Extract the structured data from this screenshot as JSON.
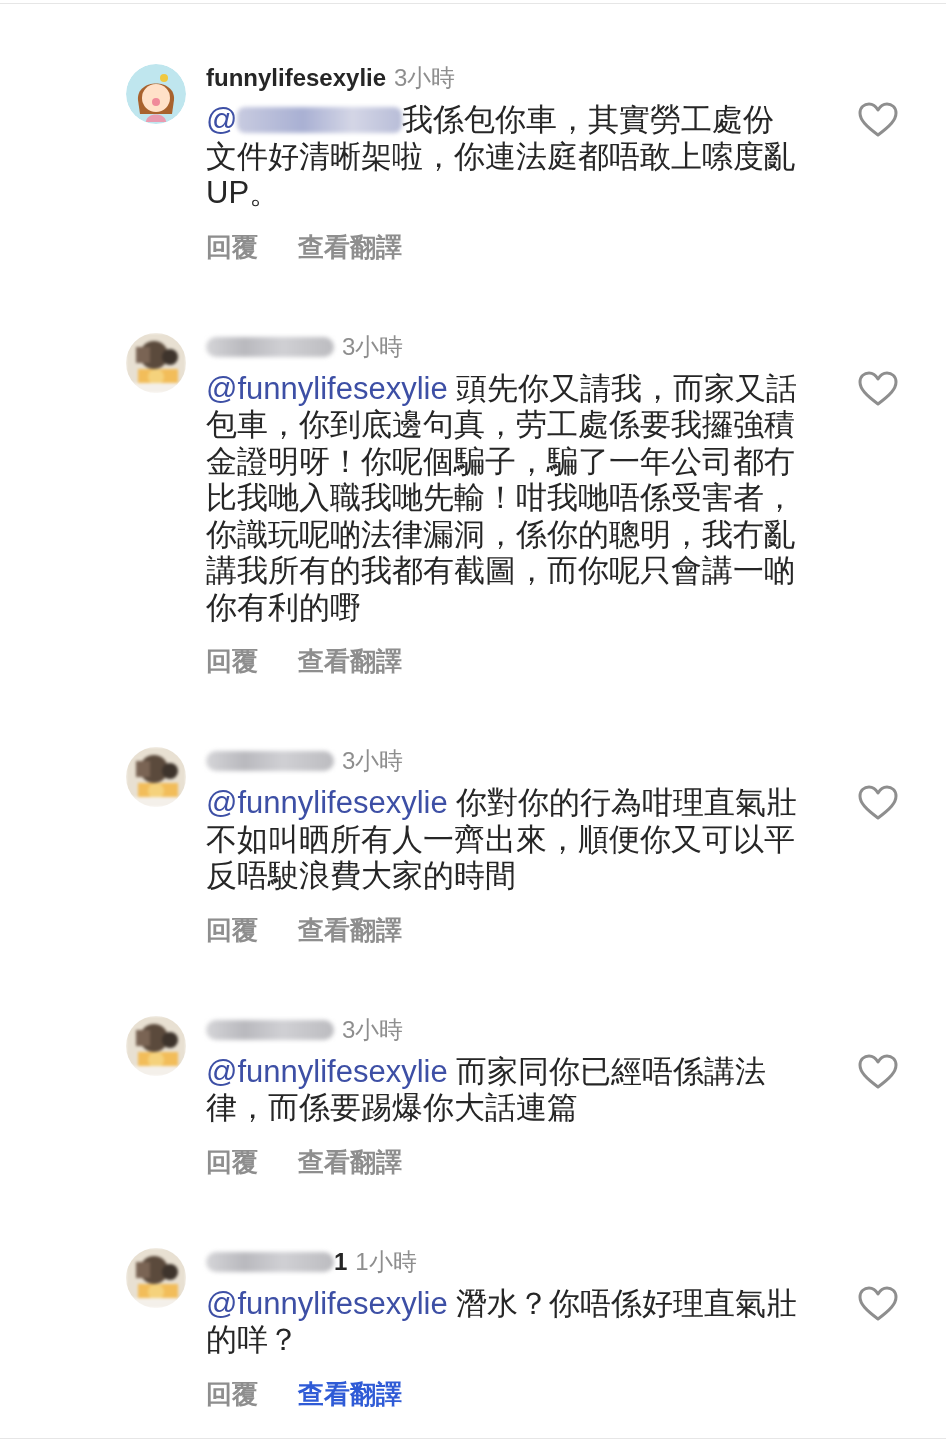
{
  "comments": [
    {
      "avatar": {
        "kind": "cartoon"
      },
      "username": "funnylifesexylie",
      "username_blurred": false,
      "time": "3小時",
      "mention": "@",
      "mention_blurred": true,
      "text": "我係包你車，其實勞工處份文件好清晰架啦，你連法庭都唔敢上嗦度亂UP。",
      "liked": false,
      "reply": "回覆",
      "translate": "查看翻譯",
      "translate_active": false
    },
    {
      "username_blurred": true,
      "time": "3小時",
      "mention": "@funnylifesexylie",
      "mention_blurred": false,
      "text": "頭先你又請我，而家又話包車，你到底邊句真，劳工處係要我攞強積金證明呀！你呢個騙子，騙了一年公司都冇比我哋入職我哋先輸！咁我哋唔係受害者，你識玩呢啲法律漏洞，係你的聰明，我冇亂講我所有的我都有截圖，而你呢只會講一啲你有利的嘢",
      "liked": false,
      "reply": "回覆",
      "translate": "查看翻譯",
      "translate_active": false
    },
    {
      "username_blurred": true,
      "time": "3小時",
      "mention": "@funnylifesexylie",
      "mention_blurred": false,
      "text": "你對你的行為咁理直氣壯不如叫晒所有人一齊出來，順便你又可以平反唔駛浪費大家的時間",
      "liked": false,
      "reply": "回覆",
      "translate": "查看翻譯",
      "translate_active": false
    },
    {
      "username_blurred": true,
      "time": "3小時",
      "mention": "@funnylifesexylie",
      "mention_blurred": false,
      "text": "而家同你已經唔係講法律，而係要踢爆你大話連篇",
      "liked": false,
      "reply": "回覆",
      "translate": "查看翻譯",
      "translate_active": false
    },
    {
      "username_blurred": true,
      "username_tail": "1",
      "time": "1小時",
      "mention": "@funnylifesexylie",
      "mention_blurred": false,
      "text": "潛水？你唔係好理直氣壯的咩？",
      "liked": false,
      "reply": "回覆",
      "translate": "查看翻譯",
      "translate_active": true
    }
  ]
}
